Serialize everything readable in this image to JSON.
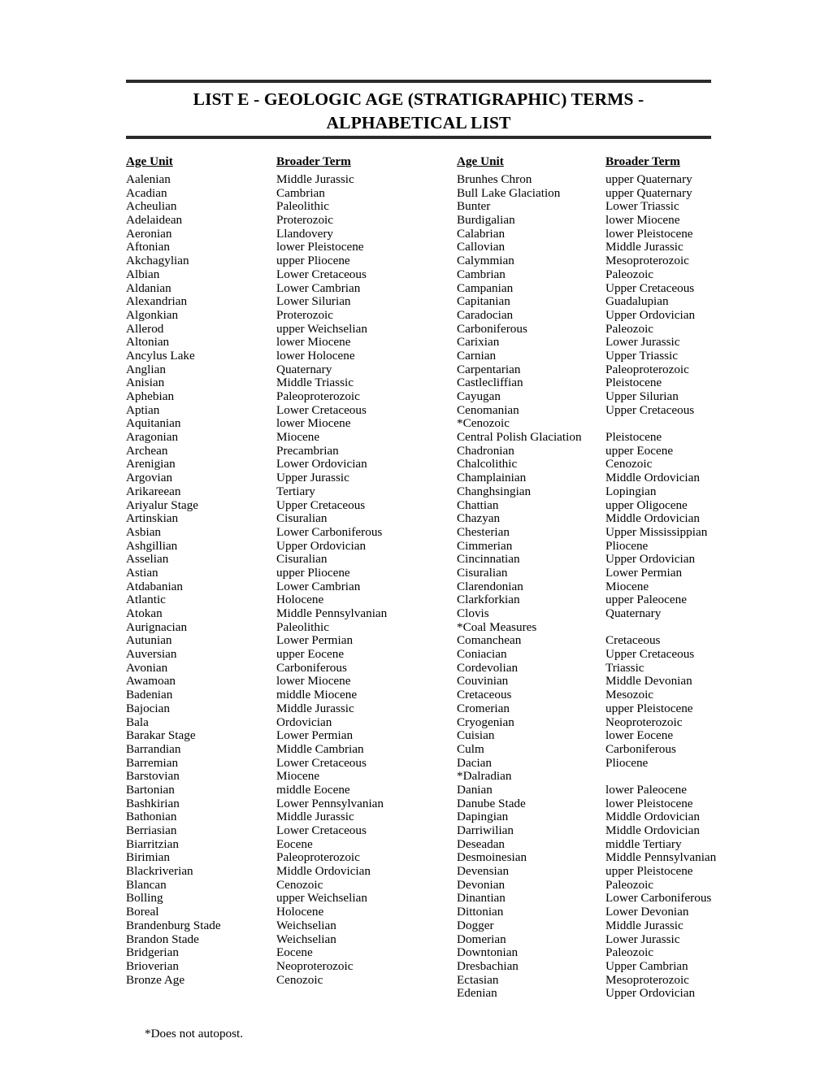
{
  "document": {
    "title": "LIST E - GEOLOGIC AGE (STRATIGRAPHIC) TERMS - ALPHABETICAL LIST",
    "footnote": "*Does not autopost.",
    "rule_color": "#2b2b2b",
    "text_color": "#000000",
    "background_color": "#ffffff"
  },
  "headers": {
    "age_unit": "Age Unit",
    "broader_term": "Broader Term"
  },
  "columns": {
    "left": [
      {
        "term": "Aalenian",
        "broader": "Middle Jurassic"
      },
      {
        "term": "Acadian",
        "broader": "Cambrian"
      },
      {
        "term": "Acheulian",
        "broader": "Paleolithic"
      },
      {
        "term": "Adelaidean",
        "broader": "Proterozoic"
      },
      {
        "term": "Aeronian",
        "broader": "Llandovery"
      },
      {
        "term": "Aftonian",
        "broader": "lower Pleistocene"
      },
      {
        "term": "Akchagylian",
        "broader": "upper Pliocene"
      },
      {
        "term": "Albian",
        "broader": "Lower Cretaceous"
      },
      {
        "term": "Aldanian",
        "broader": "Lower Cambrian"
      },
      {
        "term": "Alexandrian",
        "broader": "Lower Silurian"
      },
      {
        "term": "Algonkian",
        "broader": "Proterozoic"
      },
      {
        "term": "Allerod",
        "broader": "upper Weichselian"
      },
      {
        "term": "Altonian",
        "broader": "lower Miocene"
      },
      {
        "term": "Ancylus Lake",
        "broader": "lower Holocene"
      },
      {
        "term": "Anglian",
        "broader": "Quaternary"
      },
      {
        "term": "Anisian",
        "broader": "Middle Triassic"
      },
      {
        "term": "Aphebian",
        "broader": "Paleoproterozoic"
      },
      {
        "term": "Aptian",
        "broader": "Lower Cretaceous"
      },
      {
        "term": "Aquitanian",
        "broader": "lower Miocene"
      },
      {
        "term": "Aragonian",
        "broader": "Miocene"
      },
      {
        "term": "Archean",
        "broader": "Precambrian"
      },
      {
        "term": "Arenigian",
        "broader": "Lower Ordovician"
      },
      {
        "term": "Argovian",
        "broader": "Upper Jurassic"
      },
      {
        "term": "Arikareean",
        "broader": "Tertiary"
      },
      {
        "term": "Ariyalur Stage",
        "broader": "Upper Cretaceous"
      },
      {
        "term": "Artinskian",
        "broader": "Cisuralian"
      },
      {
        "term": "Asbian",
        "broader": "Lower Carboniferous"
      },
      {
        "term": "Ashgillian",
        "broader": "Upper Ordovician"
      },
      {
        "term": "Asselian",
        "broader": "Cisuralian"
      },
      {
        "term": "Astian",
        "broader": "upper Pliocene"
      },
      {
        "term": "Atdabanian",
        "broader": "Lower Cambrian"
      },
      {
        "term": "Atlantic",
        "broader": "Holocene"
      },
      {
        "term": "Atokan",
        "broader": "Middle Pennsylvanian"
      },
      {
        "term": "Aurignacian",
        "broader": "Paleolithic"
      },
      {
        "term": "Autunian",
        "broader": "Lower Permian"
      },
      {
        "term": "Auversian",
        "broader": "upper Eocene"
      },
      {
        "term": "Avonian",
        "broader": "Carboniferous"
      },
      {
        "term": "Awamoan",
        "broader": "lower Miocene"
      },
      {
        "term": "Badenian",
        "broader": "middle Miocene"
      },
      {
        "term": "Bajocian",
        "broader": "Middle Jurassic"
      },
      {
        "term": "Bala",
        "broader": "Ordovician"
      },
      {
        "term": "Barakar Stage",
        "broader": "Lower Permian"
      },
      {
        "term": "Barrandian",
        "broader": "Middle Cambrian"
      },
      {
        "term": "Barremian",
        "broader": "Lower Cretaceous"
      },
      {
        "term": "Barstovian",
        "broader": "Miocene"
      },
      {
        "term": "Bartonian",
        "broader": "middle Eocene"
      },
      {
        "term": "Bashkirian",
        "broader": "Lower Pennsylvanian"
      },
      {
        "term": "Bathonian",
        "broader": "Middle Jurassic"
      },
      {
        "term": "Berriasian",
        "broader": "Lower Cretaceous"
      },
      {
        "term": "Biarritzian",
        "broader": "Eocene"
      },
      {
        "term": "Birimian",
        "broader": "Paleoproterozoic"
      },
      {
        "term": "Blackriverian",
        "broader": "Middle Ordovician"
      },
      {
        "term": "Blancan",
        "broader": "Cenozoic"
      },
      {
        "term": "Bolling",
        "broader": "upper Weichselian"
      },
      {
        "term": "Boreal",
        "broader": "Holocene"
      },
      {
        "term": "Brandenburg Stade",
        "broader": "Weichselian"
      },
      {
        "term": "Brandon Stade",
        "broader": "Weichselian"
      },
      {
        "term": "Bridgerian",
        "broader": "Eocene"
      },
      {
        "term": "Brioverian",
        "broader": "Neoproterozoic"
      },
      {
        "term": "Bronze Age",
        "broader": "Cenozoic"
      }
    ],
    "right": [
      {
        "term": "Brunhes Chron",
        "broader": "upper Quaternary"
      },
      {
        "term": "Bull Lake Glaciation",
        "broader": "upper Quaternary"
      },
      {
        "term": "Bunter",
        "broader": "Lower Triassic"
      },
      {
        "term": "Burdigalian",
        "broader": "lower Miocene"
      },
      {
        "term": "Calabrian",
        "broader": "lower Pleistocene"
      },
      {
        "term": "Callovian",
        "broader": "Middle Jurassic"
      },
      {
        "term": "Calymmian",
        "broader": "Mesoproterozoic"
      },
      {
        "term": "Cambrian",
        "broader": "Paleozoic"
      },
      {
        "term": "Campanian",
        "broader": "Upper Cretaceous"
      },
      {
        "term": "Capitanian",
        "broader": "Guadalupian"
      },
      {
        "term": "Caradocian",
        "broader": "Upper Ordovician"
      },
      {
        "term": "Carboniferous",
        "broader": "Paleozoic"
      },
      {
        "term": "Carixian",
        "broader": "Lower Jurassic"
      },
      {
        "term": "Carnian",
        "broader": "Upper Triassic"
      },
      {
        "term": "Carpentarian",
        "broader": "Paleoproterozoic"
      },
      {
        "term": "Castlecliffian",
        "broader": "Pleistocene"
      },
      {
        "term": "Cayugan",
        "broader": "Upper Silurian"
      },
      {
        "term": "Cenomanian",
        "broader": "Upper Cretaceous"
      },
      {
        "term": "*Cenozoic",
        "broader": ""
      },
      {
        "term": "Central Polish Glaciation",
        "broader": "Pleistocene"
      },
      {
        "term": "Chadronian",
        "broader": "upper Eocene"
      },
      {
        "term": "Chalcolithic",
        "broader": "Cenozoic"
      },
      {
        "term": "Champlainian",
        "broader": "Middle Ordovician"
      },
      {
        "term": "Changhsingian",
        "broader": "Lopingian"
      },
      {
        "term": "Chattian",
        "broader": "upper Oligocene"
      },
      {
        "term": "Chazyan",
        "broader": "Middle Ordovician"
      },
      {
        "term": "Chesterian",
        "broader": "Upper Mississippian"
      },
      {
        "term": "Cimmerian",
        "broader": "Pliocene"
      },
      {
        "term": "Cincinnatian",
        "broader": "Upper Ordovician"
      },
      {
        "term": "Cisuralian",
        "broader": "Lower Permian"
      },
      {
        "term": "Clarendonian",
        "broader": "Miocene"
      },
      {
        "term": "Clarkforkian",
        "broader": "upper Paleocene"
      },
      {
        "term": "Clovis",
        "broader": "Quaternary"
      },
      {
        "term": "*Coal Measures",
        "broader": ""
      },
      {
        "term": "Comanchean",
        "broader": "Cretaceous"
      },
      {
        "term": "Coniacian",
        "broader": "Upper Cretaceous"
      },
      {
        "term": "Cordevolian",
        "broader": "Triassic"
      },
      {
        "term": "Couvinian",
        "broader": "Middle Devonian"
      },
      {
        "term": "Cretaceous",
        "broader": "Mesozoic"
      },
      {
        "term": "Cromerian",
        "broader": "upper Pleistocene"
      },
      {
        "term": "Cryogenian",
        "broader": "Neoproterozoic"
      },
      {
        "term": "Cuisian",
        "broader": "lower Eocene"
      },
      {
        "term": "Culm",
        "broader": "Carboniferous"
      },
      {
        "term": "Dacian",
        "broader": "Pliocene"
      },
      {
        "term": "*Dalradian",
        "broader": ""
      },
      {
        "term": "Danian",
        "broader": "lower Paleocene"
      },
      {
        "term": "Danube Stade",
        "broader": "lower Pleistocene"
      },
      {
        "term": "Dapingian",
        "broader": "Middle Ordovician"
      },
      {
        "term": "Darriwilian",
        "broader": "Middle Ordovician"
      },
      {
        "term": "Deseadan",
        "broader": "middle Tertiary"
      },
      {
        "term": "Desmoinesian",
        "broader": "Middle Pennsylvanian"
      },
      {
        "term": "Devensian",
        "broader": "upper Pleistocene"
      },
      {
        "term": "Devonian",
        "broader": "Paleozoic"
      },
      {
        "term": "Dinantian",
        "broader": "Lower Carboniferous"
      },
      {
        "term": "Dittonian",
        "broader": "Lower Devonian"
      },
      {
        "term": "Dogger",
        "broader": "Middle Jurassic"
      },
      {
        "term": "Domerian",
        "broader": "Lower Jurassic"
      },
      {
        "term": "Downtonian",
        "broader": "Paleozoic"
      },
      {
        "term": "Dresbachian",
        "broader": "Upper Cambrian"
      },
      {
        "term": "Ectasian",
        "broader": "Mesoproterozoic"
      },
      {
        "term": "Edenian",
        "broader": "Upper Ordovician"
      }
    ]
  }
}
